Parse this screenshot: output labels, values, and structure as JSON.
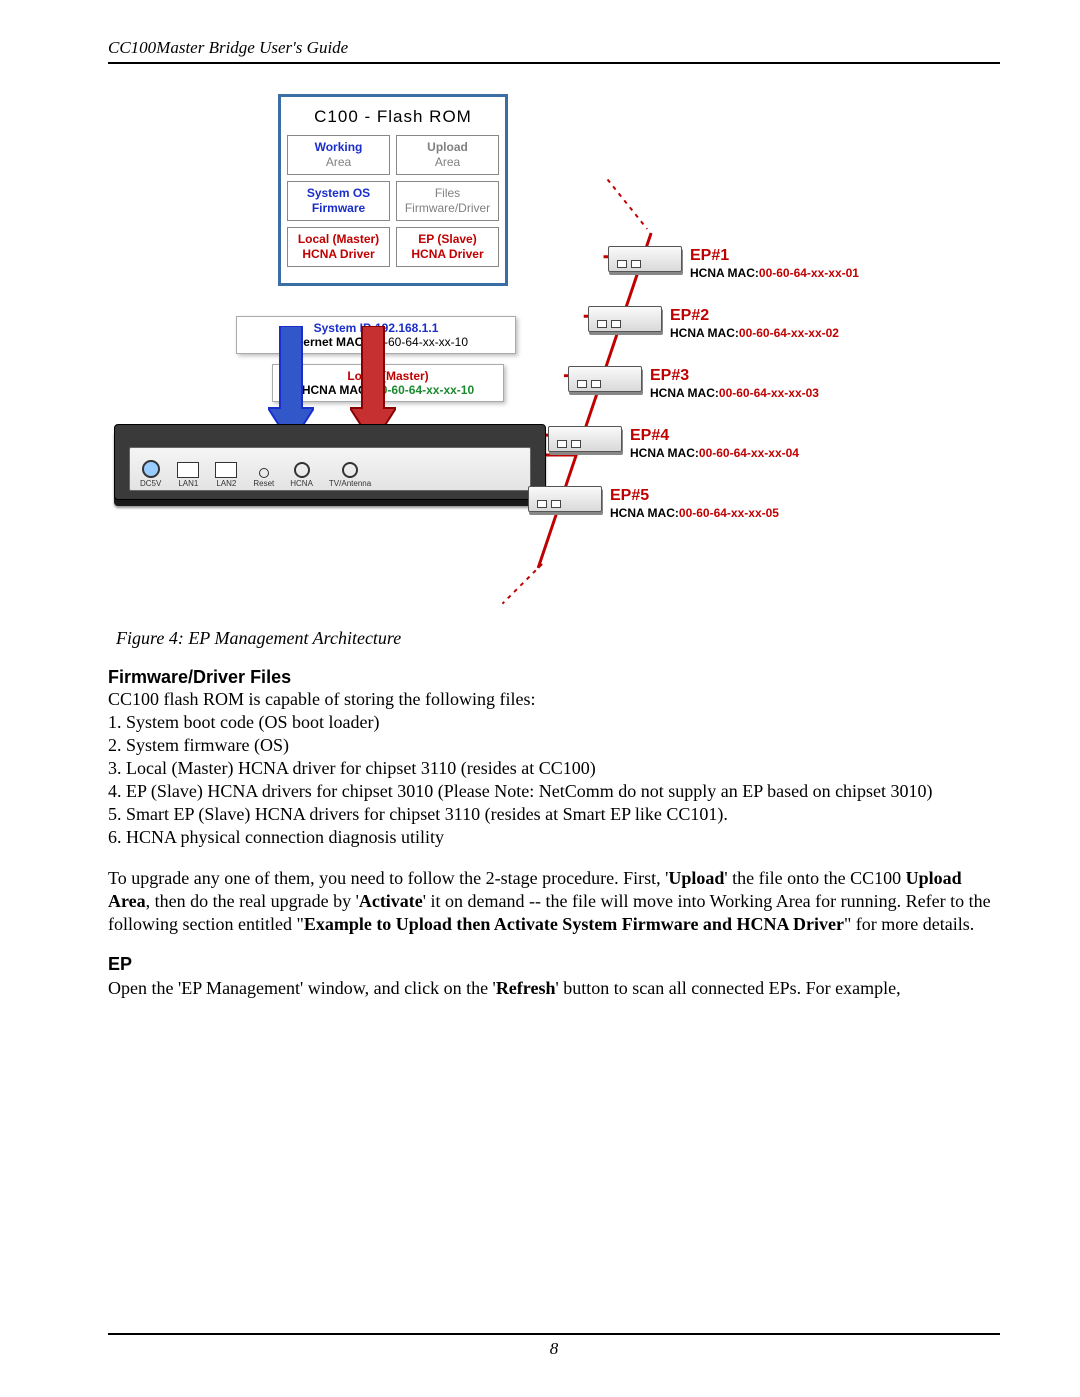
{
  "running_head": "CC100Master Bridge User's Guide",
  "page_number": "8",
  "figure": {
    "caption": "Figure 4: EP Management Architecture",
    "flash_rom_title": "C100 - Flash ROM",
    "rom": {
      "working_label": "Working",
      "upload_label": "Upload",
      "area_label": "Area",
      "sys_os": "System OS",
      "firmware": "Firmware",
      "files": "Files",
      "firmware_driver": "Firmware/Driver",
      "local_master": "Local (Master)",
      "hcna_driver": "HCNA Driver",
      "ep_slave": "EP (Slave)"
    },
    "system_ip_label": "System IP:",
    "system_ip_value": "192.168.1.1",
    "eth_mac_label": "Ethernet MAC:",
    "eth_mac_value": "00-60-64-xx-xx-10",
    "local_mac_title": "Local (Master)",
    "local_mac_label": "HCNA MAC:",
    "local_mac_value": "00-60-64-xx-xx-10",
    "ports": {
      "dc5v": "DC5V",
      "lan1": "LAN1",
      "lan2": "LAN2",
      "reset": "Reset",
      "hcna": "HCNA",
      "tv": "TV/Antenna"
    },
    "mac_label": "HCNA MAC:",
    "eps": [
      {
        "name": "EP#1",
        "mac": "00-60-64-xx-xx-01"
      },
      {
        "name": "EP#2",
        "mac": "00-60-64-xx-xx-02"
      },
      {
        "name": "EP#3",
        "mac": "00-60-64-xx-xx-03"
      },
      {
        "name": "EP#4",
        "mac": "00-60-64-xx-xx-04"
      },
      {
        "name": "EP#5",
        "mac": "00-60-64-xx-xx-05"
      }
    ]
  },
  "section1": {
    "heading": "Firmware/Driver Files",
    "intro": "CC100 flash ROM is capable of storing the following files:",
    "items": [
      "1. System boot code (OS boot loader)",
      "2. System firmware (OS)",
      "3. Local (Master) HCNA driver for chipset 3110 (resides at CC100)",
      "4. EP (Slave) HCNA drivers for chipset 3010 (Please Note: NetComm do not supply an EP based on chipset 3010)",
      "5. Smart EP (Slave) HCNA drivers for chipset 3110 (resides at Smart EP like CC101).",
      "6. HCNA physical connection diagnosis utility"
    ],
    "para_parts": {
      "p1": "To upgrade any one of them, you need to follow the 2-stage procedure. First, '",
      "b1": "Upload",
      "p2": "' the file onto the CC100 ",
      "b2": "Upload Area",
      "p3": ", then do the real upgrade by '",
      "b3": "Activate",
      "p4": "' it on demand -- the file will move into Working Area for running.  Refer to the following section entitled \"",
      "b4": "Example to Upload then Activate System Firmware and HCNA Driver",
      "p5": "\" for more details."
    }
  },
  "section2": {
    "heading": "EP",
    "para_parts": {
      "p1": "Open the 'EP Management' window, and click on the '",
      "b1": "Refresh",
      "p2": "' button to scan all connected EPs. For example,"
    }
  }
}
